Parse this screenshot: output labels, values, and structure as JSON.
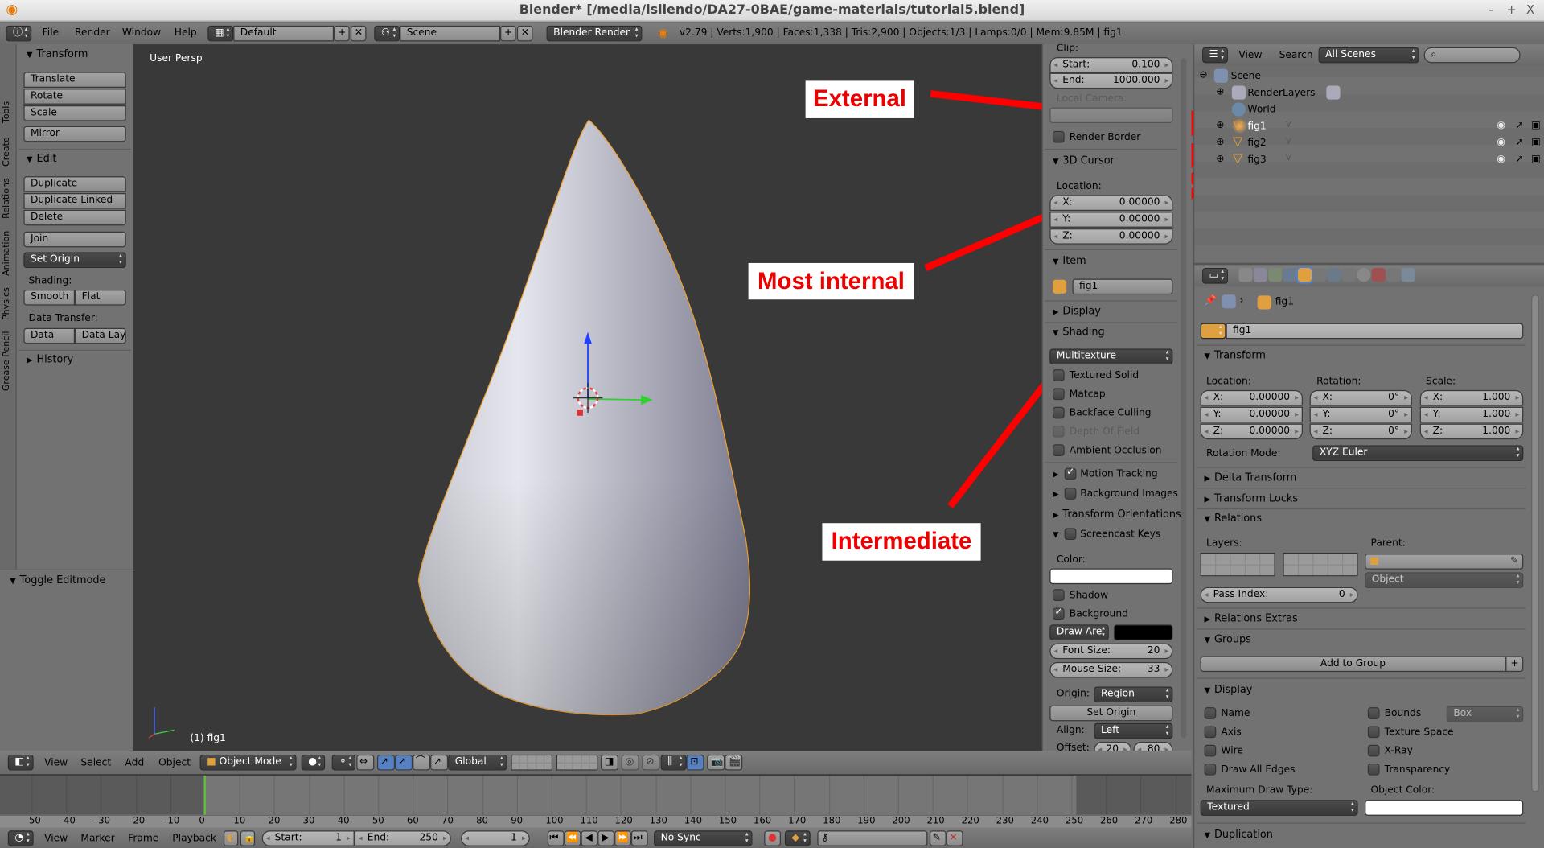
{
  "titlebar": {
    "title": "Blender* [/media/isliendo/DA27-0BAE/game-materials/tutorial5.blend]",
    "controls": [
      "-",
      "+",
      "X"
    ]
  },
  "info_header": {
    "menus": [
      "File",
      "Render",
      "Window",
      "Help"
    ],
    "layout": "Default",
    "scene": "Scene",
    "engine": "Blender Render",
    "stats": "v2.79 | Verts:1,900 | Faces:1,338 | Tris:2,900 | Objects:1/3 | Lamps:0/0 | Mem:9.85M | fig1"
  },
  "side_tabs": [
    "Tools",
    "Create",
    "Relations",
    "Animation",
    "Physics",
    "Grease Pencil"
  ],
  "toolshelf": {
    "transform": {
      "title": "Transform",
      "buttons": [
        "Translate",
        "Rotate",
        "Scale",
        "Mirror"
      ]
    },
    "edit": {
      "title": "Edit",
      "buttons": [
        "Duplicate",
        "Duplicate Linked",
        "Delete",
        "Join"
      ],
      "set_origin": "Set Origin",
      "shading_label": "Shading:",
      "smooth": "Smooth",
      "flat": "Flat",
      "data_transfer_label": "Data Transfer:",
      "data": "Data",
      "data_layo": "Data Layo"
    },
    "history": "History",
    "toggle_editmode": "Toggle Editmode"
  },
  "viewport": {
    "view_name": "User Persp",
    "object_label": "(1) fig1",
    "colors": {
      "bg": "#393939",
      "outline": "#f0a030"
    }
  },
  "annotations": {
    "external": "External",
    "most_internal": "Most internal",
    "intermediate": "Intermediate",
    "color": "#ff0000"
  },
  "npanel": {
    "clip": "Clip:",
    "start_label": "Start:",
    "start": "0.100",
    "end_label": "End:",
    "end": "1000.000",
    "local_camera": "Local Camera:",
    "render_border": "Render Border",
    "cursor_title": "3D Cursor",
    "location": "Location:",
    "x_label": "X:",
    "y_label": "Y:",
    "z_label": "Z:",
    "cx": "0.00000",
    "cy": "0.00000",
    "cz": "0.00000",
    "item_title": "Item",
    "item_name": "fig1",
    "display": "Display",
    "shading": "Shading",
    "shading_mode": "Multitexture",
    "textured_solid": "Textured Solid",
    "matcap": "Matcap",
    "backface": "Backface Culling",
    "dof": "Depth Of Field",
    "ao": "Ambient Occlusion",
    "motion_tracking": "Motion Tracking",
    "bg_images": "Background Images",
    "orientations": "Transform Orientations",
    "screencast": "Screencast Keys",
    "color": "Color:",
    "shadow": "Shadow",
    "background": "Background",
    "draw_area": "Draw Are",
    "font_size_label": "Font Size:",
    "font_size": "20",
    "mouse_size_label": "Mouse Size:",
    "mouse_size": "33",
    "origin": "Origin:",
    "origin_value": "Region",
    "set_origin": "Set Origin",
    "align": "Align:",
    "align_value": "Left",
    "offset": "Offset:",
    "offset_x": "20",
    "offset_y": "80"
  },
  "outliner": {
    "view": "View",
    "search": "Search",
    "filter": "All Scenes",
    "search_placeholder": "",
    "rows": [
      "Scene",
      "RenderLayers",
      "World",
      "fig1",
      "fig2",
      "fig3"
    ]
  },
  "properties": {
    "breadcrumb": "fig1",
    "name": "fig1",
    "transform": "Transform",
    "location": "Location:",
    "rotation": "Rotation:",
    "scale": "Scale:",
    "x": "X:",
    "y": "Y:",
    "z": "Z:",
    "loc": [
      "0.00000",
      "0.00000",
      "0.00000"
    ],
    "rot": [
      "0°",
      "0°",
      "0°"
    ],
    "scl": [
      "1.000",
      "1.000",
      "1.000"
    ],
    "rotation_mode_label": "Rotation Mode:",
    "rotation_mode": "XYZ Euler",
    "delta_transform": "Delta Transform",
    "transform_locks": "Transform Locks",
    "relations": "Relations",
    "layers": "Layers:",
    "parent": "Parent:",
    "parent_type": "Object",
    "pass_index_label": "Pass Index:",
    "pass_index": "0",
    "relations_extras": "Relations Extras",
    "groups": "Groups",
    "add_to_group": "Add to Group",
    "display": "Display",
    "name_chk": "Name",
    "bounds": "Bounds",
    "bounds_type": "Box",
    "axis": "Axis",
    "texture_space": "Texture Space",
    "wire": "Wire",
    "xray": "X-Ray",
    "draw_all_edges": "Draw All Edges",
    "transparency": "Transparency",
    "max_draw_type_label": "Maximum Draw Type:",
    "max_draw_type": "Textured",
    "object_color": "Object Color:",
    "duplication": "Duplication"
  },
  "view3d_header": {
    "menus": [
      "View",
      "Select",
      "Add",
      "Object"
    ],
    "mode": "Object Mode",
    "orientation": "Global"
  },
  "timeline": {
    "current_frame_marker": 0,
    "ruler_ticks": [
      -50,
      -40,
      -30,
      -20,
      -10,
      0,
      10,
      20,
      30,
      40,
      50,
      60,
      70,
      80,
      90,
      100,
      110,
      120,
      130,
      140,
      150,
      160,
      170,
      180,
      190,
      200,
      210,
      220,
      230,
      240,
      250,
      260,
      270,
      280
    ],
    "menus": [
      "View",
      "Marker",
      "Frame",
      "Playback"
    ],
    "start_label": "Start:",
    "start": "1",
    "end_label": "End:",
    "end": "250",
    "current": "1",
    "sync": "No Sync"
  }
}
